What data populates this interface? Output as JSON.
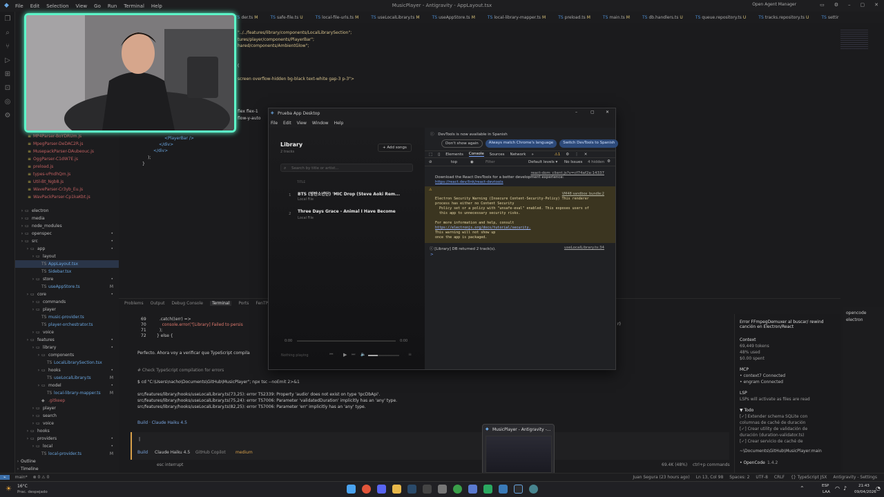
{
  "window": {
    "menu": [
      "File",
      "Edit",
      "Selection",
      "View",
      "Go",
      "Run",
      "Terminal",
      "Help"
    ],
    "title": "MusicPlayer - Antigravity - AppLayout.tsx",
    "agent_manager": "Open Agent Manager"
  },
  "tabs": [
    {
      "name": "der.ts",
      "mod": "M"
    },
    {
      "name": "safe-file.ts",
      "mod": "U"
    },
    {
      "name": "local-file-urls.ts",
      "mod": "M"
    },
    {
      "name": "useLocalLibrary.ts",
      "mod": "M"
    },
    {
      "name": "useAppStore.ts",
      "mod": "M"
    },
    {
      "name": "local-library-mapper.ts",
      "mod": "M"
    },
    {
      "name": "preload.ts",
      "mod": "M"
    },
    {
      "name": "main.ts",
      "mod": "M"
    },
    {
      "name": "db.handlers.ts",
      "mod": "U"
    },
    {
      "name": "queue.repository.ts",
      "mod": "U"
    },
    {
      "name": "tracks.repository.ts",
      "mod": "U"
    },
    {
      "name": "settir",
      "mod": ""
    }
  ],
  "code": {
    "line1": "\"../../features/library/components/LocalLibrarySection\";",
    "line2": "tures/player/components/PlayerBar\";",
    "line3": "hared/components/AmbientGlow\";",
    "line4": "(",
    "line5": "screen overflow-hidden bg-black text-white gap-3 p-3\">",
    "line6": "flex flex-1",
    "line7": "flow-y-auto",
    "line8": "<PlayerBar />",
    "line9": "</div>",
    "line10": "</div>",
    "line11": ");",
    "line12": "}"
  },
  "sidebar": {
    "files": [
      {
        "name": "MP4Parser-BoYDRUm.js",
        "type": "js"
      },
      {
        "name": "MpegParser-DeDAC2R.js",
        "type": "js"
      },
      {
        "name": "MusepackParser-DAubeouc.js",
        "type": "js"
      },
      {
        "name": "OggParser-C1dW7E.js",
        "type": "js"
      },
      {
        "name": "preload.js",
        "type": "js"
      },
      {
        "name": "types-vPndhQm.js",
        "type": "js"
      },
      {
        "name": "Util-Bt_Ngb8.js",
        "type": "js"
      },
      {
        "name": "WaveParser-Cr3yb_Eu.js",
        "type": "js"
      },
      {
        "name": "WavPackParser-Cp1kaKbt.js",
        "type": "js"
      }
    ],
    "tree": [
      {
        "label": "electron",
        "kind": "folder",
        "depth": 0,
        "badge": ""
      },
      {
        "label": "media",
        "kind": "folder",
        "depth": 0,
        "badge": ""
      },
      {
        "label": "node_modules",
        "kind": "folder",
        "depth": 0,
        "badge": ""
      },
      {
        "label": "openspec",
        "kind": "folder",
        "depth": 0,
        "badge": "•"
      },
      {
        "label": "src",
        "kind": "folder",
        "depth": 0,
        "badge": "•"
      },
      {
        "label": "app",
        "kind": "folder",
        "depth": 1,
        "badge": "•"
      },
      {
        "label": "layout",
        "kind": "folder",
        "depth": 2,
        "badge": ""
      },
      {
        "label": "AppLayout.tsx",
        "kind": "ts",
        "depth": 3,
        "badge": "",
        "selected": true
      },
      {
        "label": "Sidebar.tsx",
        "kind": "ts",
        "depth": 3,
        "badge": ""
      },
      {
        "label": "store",
        "kind": "folder",
        "depth": 2,
        "badge": "•"
      },
      {
        "label": "useAppStore.ts",
        "kind": "ts",
        "depth": 3,
        "badge": "M"
      },
      {
        "label": "core",
        "kind": "folder",
        "depth": 1,
        "badge": "•"
      },
      {
        "label": "commands",
        "kind": "folder",
        "depth": 2,
        "badge": ""
      },
      {
        "label": "player",
        "kind": "folder",
        "depth": 2,
        "badge": ""
      },
      {
        "label": "music-provider.ts",
        "kind": "ts",
        "depth": 3,
        "badge": ""
      },
      {
        "label": "player-orchestrator.ts",
        "kind": "ts",
        "depth": 3,
        "badge": ""
      },
      {
        "label": "voice",
        "kind": "folder",
        "depth": 2,
        "badge": ""
      },
      {
        "label": "features",
        "kind": "folder",
        "depth": 1,
        "badge": "•"
      },
      {
        "label": "library",
        "kind": "folder",
        "depth": 2,
        "badge": "•"
      },
      {
        "label": "components",
        "kind": "folder",
        "depth": 3,
        "badge": ""
      },
      {
        "label": "LocalLibrarySection.tsx",
        "kind": "ts",
        "depth": 4,
        "badge": ""
      },
      {
        "label": "hooks",
        "kind": "folder",
        "depth": 3,
        "badge": "•"
      },
      {
        "label": "useLocalLibrary.ts",
        "kind": "ts",
        "depth": 4,
        "badge": "M"
      },
      {
        "label": "model",
        "kind": "folder",
        "depth": 3,
        "badge": "•"
      },
      {
        "label": "local-library-mapper.ts",
        "kind": "ts",
        "depth": 4,
        "badge": "M"
      },
      {
        "label": ".gitkeep",
        "kind": "git",
        "depth": 3,
        "badge": ""
      },
      {
        "label": "player",
        "kind": "folder",
        "depth": 2,
        "badge": ""
      },
      {
        "label": "search",
        "kind": "folder",
        "depth": 2,
        "badge": ""
      },
      {
        "label": "voice",
        "kind": "folder",
        "depth": 2,
        "badge": ""
      },
      {
        "label": "hooks",
        "kind": "folder",
        "depth": 1,
        "badge": ""
      },
      {
        "label": "providers",
        "kind": "folder",
        "depth": 1,
        "badge": "•"
      },
      {
        "label": "local",
        "kind": "folder",
        "depth": 2,
        "badge": "•"
      },
      {
        "label": "local-provider.ts",
        "kind": "ts",
        "depth": 3,
        "badge": "M"
      }
    ],
    "outline": "Outline",
    "timeline": "Timeline"
  },
  "panel": {
    "tabs": [
      "Problems",
      "Output",
      "Debug Console",
      "Terminal",
      "Ports",
      "FenTP"
    ],
    "active_tab": "Terminal",
    "code_lines": [
      {
        "n": "69",
        "text": "  .catch((err) =>"
      },
      {
        "n": "70",
        "text": "    console.error(\"[Library] Failed to persis"
      },
      {
        "n": "71",
        "text": "  );"
      },
      {
        "n": "72",
        "text": "} else {"
      }
    ],
    "msg1": "Perfecto. Ahora voy a verificar que TypeScript compila",
    "comment": "# Check TypeScript compilation for errors",
    "command": "$ cd \"C:\\Users\\nacho\\Documents\\GitHub\\MusicPlayer\"; npx tsc --noEmit 2>&1",
    "errors": [
      "src/features/library/hooks/useLocalLibrary.ts(73,25): error TS2339: Property 'audio' does not exist on type 'IpcDbApi'.",
      "src/features/library/hooks/useLocalLibrary.ts(75,24): error TS7006: Parameter 'validatedDuration' implicitly has an 'any' type.",
      "src/features/library/hooks/useLocalLibrary.ts(82,25): error TS7006: Parameter 'err' implicitly has an 'any' type."
    ],
    "build_status": "Build · Claude Haiku 4.5",
    "input_cursor": "|",
    "mode_bar": {
      "mode": "Build",
      "model": "Claude Haiku 4.5",
      "provider": "GitHub Copilot",
      "effort": "medium"
    },
    "interrupt": "esc interrupt",
    "tokens_right": "69.4K (48%)",
    "shortcut": "ctrl+p commands",
    "stray": "r)"
  },
  "agent": {
    "title": "Error FFmpegDemuxer al buscar/ rewind canción en Electron/React",
    "context_head": "Context",
    "context_lines": [
      "69,449 tokens",
      "48% used",
      "$0.00 spent"
    ],
    "mcp_head": "MCP",
    "mcp_lines": [
      "• context7 Connected",
      "• engram Connected"
    ],
    "lsp_head": "LSP",
    "lsp_line": "LSPs will activate as files are read",
    "todo_head": "▼ Todo",
    "todos": [
      "[✓] Extender schema SQLite con",
      "    columnas de caché de duración",
      "[✓] Crear utility de validación de",
      "    duración (duration-validator.ts)",
      "[✓] Crear servicio de caché de"
    ],
    "path": "~\\Documents\\GitHub\\MusicPlayer:main",
    "version_label": "• OpenCode",
    "version": "1.4.2"
  },
  "outline_panel": [
    "opencode",
    "electron"
  ],
  "status": {
    "remote": "main*",
    "issues": "⊗ 0 ⚠ 0",
    "right": [
      "Juan Segura (23 hours ago)",
      "Ln 13, Col 98",
      "Spaces: 2",
      "UTF-8",
      "CRLF",
      "{} TypeScript JSX",
      "Antigravity - Settings"
    ]
  },
  "taskbar": {
    "weather_temp": "16°C",
    "weather_text": "Prac. despejado",
    "lang": "ESP",
    "lang2": "LAA",
    "time": "21:43",
    "date": "09/04/2026",
    "preview_title": "MusicPlayer - Antigravity -..."
  },
  "app": {
    "title": "Prueba App Desktop",
    "menu": [
      "File",
      "Edit",
      "View",
      "Window",
      "Help"
    ],
    "library_title": "Library",
    "track_count": "2 tracks",
    "add_songs": "+ Add songs",
    "search_placeholder": "Search by title or artist...",
    "col_title": "TITLE",
    "tracks": [
      {
        "num": "1",
        "title": "BTS (방탄소년단) 'MIC Drop (Steve Aoki Rem...",
        "sub": "Local File"
      },
      {
        "num": "2",
        "title": "Three Days Grace - Animal I Have Become",
        "sub": "Local File"
      }
    ],
    "time_start": "0:00",
    "time_end": "0:00",
    "nothing_playing": "Nothing playing"
  },
  "devtools": {
    "banner": "DevTools is now available in Spanish",
    "btn1": "Don't show again",
    "btn2": "Always match Chrome's language",
    "btn3": "Switch DevTools to Spanish",
    "tabs": [
      "Elements",
      "Console",
      "Sources",
      "Network",
      "»"
    ],
    "active_tab": "Console",
    "warn_count": "1",
    "context": "top",
    "filter_placeholder": "Filter",
    "levels": "Default levels ▾",
    "no_issues": "No Issues",
    "hidden": "4 hidden",
    "link1": "react-dom_client.js?v=cf74af2a:14337",
    "msg1": "Download the React DevTools for a better development experience:",
    "msg1_link": "https://react.dev/link/react-devtools",
    "warn_link": "VM48 sandbox_bundle:2",
    "warn_lines": [
      "Electron Security Warning (Insecure Content-Security-Policy) This renderer",
      "process has either no Content Security",
      "  Policy set or a policy with \"unsafe-eval\" enabled. This exposes users of",
      "  this app to unnecessary security risks.",
      "",
      "For more information and help, consult",
      "https://electronjs.org/docs/tutorial/security.",
      "This warning will not show up",
      "once the app is packaged."
    ],
    "info": "[Library] DB returned 2 track(s).",
    "info_link": "useLocalLibrary.ts:34",
    "prompt": ">"
  }
}
